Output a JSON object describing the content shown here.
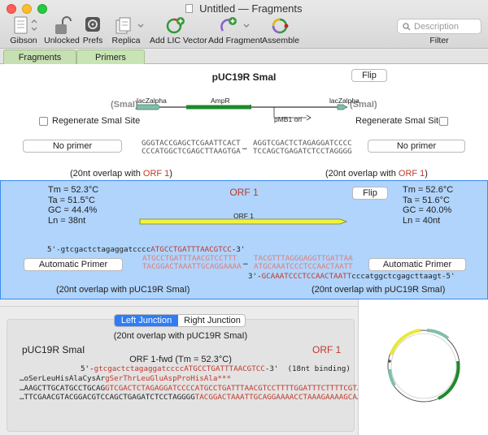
{
  "window": {
    "title": "Untitled — Fragments"
  },
  "toolbar": {
    "gibson": "Gibson",
    "unlocked": "Unlocked",
    "prefs": "Prefs",
    "replica": "Replica",
    "add_lic_vector": "Add LIC Vector",
    "add_fragment": "Add Fragment",
    "assemble": "Assemble",
    "filter": "Filter",
    "search_placeholder": "Description"
  },
  "tabs": {
    "fragments": "Fragments",
    "primers": "Primers"
  },
  "vector": {
    "name": "pUC19R SmaI",
    "flip": "Flip",
    "site_left": "(SmaI)",
    "site_right": "(SmaI)",
    "feature_left": "lacZalpha",
    "feature_mid": "AmpR",
    "feature_right": "lacZalpha",
    "feature_ori": "pMB1 ori",
    "regen_left": "Regenerate SmaI Site",
    "regen_right": "Regenerate SmaI Site",
    "seq_top_left": "GGGTACCGAGCTCGAATTCACT",
    "seq_bot_left": "CCCATGGCTCGAGCTTAAGTGA",
    "seq_top_right": "AGGTCGACTCTAGAGGATCCCC",
    "seq_bot_right": "TCCAGCTGAGATCTCCTAGGGG",
    "ellipsis": "…",
    "primer_left": "No primer",
    "primer_right": "No primer",
    "overlap_left_prefix": "(20nt overlap with ",
    "overlap_left_target": "ORF 1",
    "overlap_left_suffix": ")",
    "overlap_right_prefix": "(20nt overlap with ",
    "overlap_right_target": "ORF 1",
    "overlap_right_suffix": ")"
  },
  "orf": {
    "name": "ORF 1",
    "flip": "Flip",
    "arrow_label": "ORF 1",
    "left_stats": {
      "tm": "Tm = 52.3°C",
      "ta": "Ta = 51.5°C",
      "gc": "GC = 44.4%",
      "ln": "Ln = 38nt"
    },
    "right_stats": {
      "tm": "Tm = 52.6°C",
      "ta": "Ta = 51.6°C",
      "gc": "GC = 40.0%",
      "ln": "Ln = 40nt"
    },
    "fwd_primer_black": "5'-gtcgactctagaggatcccc",
    "fwd_primer_red": "ATGCCTGATTTAACGTCC",
    "fwd_primer_end": "-3'",
    "seq_top_left": "ATGCCTGATTTAACGTCCTTT",
    "seq_bot_left": "TACGGACTAAATTGCAGGAAAA",
    "seq_top_right": "TACGTTTAGGGAGGTTGATTAA",
    "seq_bot_right": "ATGCAAATCCCTCCAACTAATT",
    "ellipsis": "…",
    "rev_primer_start": "3'-",
    "rev_primer_red": "GCAAATCCCTCCAACTAATT",
    "rev_primer_black": "cccatggctcgagcttaagt-5'",
    "primer_left": "Automatic Primer",
    "primer_right": "Automatic Primer",
    "overlap_left": "(20nt overlap with pUC19R SmaI)",
    "overlap_right": "(20nt overlap with pUC19R SmaI)"
  },
  "junction": {
    "tab_left": "Left Junction",
    "tab_right": "Right Junction",
    "overlap": "(20nt overlap with pUC19R SmaI)",
    "left_name": "pUC19R SmaI",
    "right_name": "ORF 1",
    "primer_title": "ORF 1-fwd (Tm = 52.3°C)",
    "primer_black": "5'-",
    "primer_red": "gtcgactctagaggatccccATGCCTGATTTAACGTCC",
    "primer_end": "-3'  (18nt binding)",
    "aa_black": "…oSerLeuHisAlaCysAr",
    "aa_red": "gSerThrLeuGluAspProHisAla***",
    "top_black": "…AAGCTTGCATGCCTGCAG",
    "top_red": "GTCGACTCTAGAGGATCCCCATGCCTGATTTAACGTCCTTTTGGATTTCTTTTCGT…",
    "bot_black": "…TTCGAACGTACGGACGTCCAGCTGAGATCTCCTAGGGG",
    "bot_red": "TACGGACTAAATTGCAGGAAAACCTAAAGAAAAGCA…"
  },
  "colors": {
    "accent": "#3e8bef",
    "orf_panel": "#b0d4fb",
    "ampr": "#1e8a2a",
    "lacz": "#7fbfa8",
    "orf_arrow": "#f2f23a",
    "red_text": "#c0392b"
  }
}
